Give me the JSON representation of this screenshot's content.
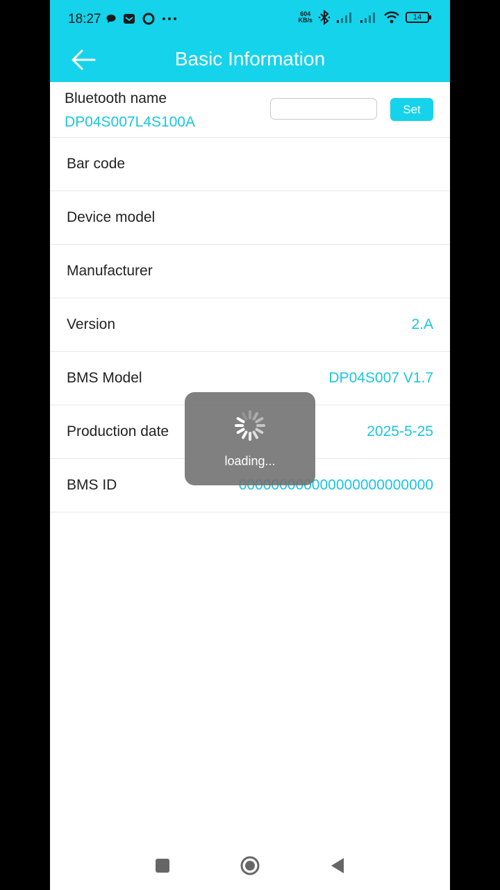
{
  "status_bar": {
    "time": "18:27",
    "net_speed_value": "604",
    "net_speed_unit": "KB/s",
    "battery": "14",
    "icons": [
      "chat-bubble-icon",
      "mail-icon",
      "circle-icon",
      "more-dots-icon",
      "bluetooth-icon",
      "signal-icon",
      "signal-icon",
      "wifi-icon",
      "battery-icon"
    ]
  },
  "app_bar": {
    "title": "Basic Information",
    "back_icon": "arrow-left-icon"
  },
  "bluetooth": {
    "label": "Bluetooth name",
    "value": "DP04S007L4S100A",
    "input_value": "",
    "set_label": "Set"
  },
  "info_rows": [
    {
      "label": "Bar code",
      "value": ""
    },
    {
      "label": "Device model",
      "value": ""
    },
    {
      "label": "Manufacturer",
      "value": ""
    },
    {
      "label": "Version",
      "value": "2.A"
    },
    {
      "label": "BMS Model",
      "value": "DP04S007 V1.7"
    },
    {
      "label": "Production date",
      "value": "2025-5-25"
    },
    {
      "label": "BMS ID",
      "value": "000000000000000000000000"
    }
  ],
  "loading": {
    "text": "loading..."
  },
  "colors": {
    "accent": "#14d3eb",
    "value_text": "#19c6de",
    "overlay": "#6e6e6e"
  }
}
